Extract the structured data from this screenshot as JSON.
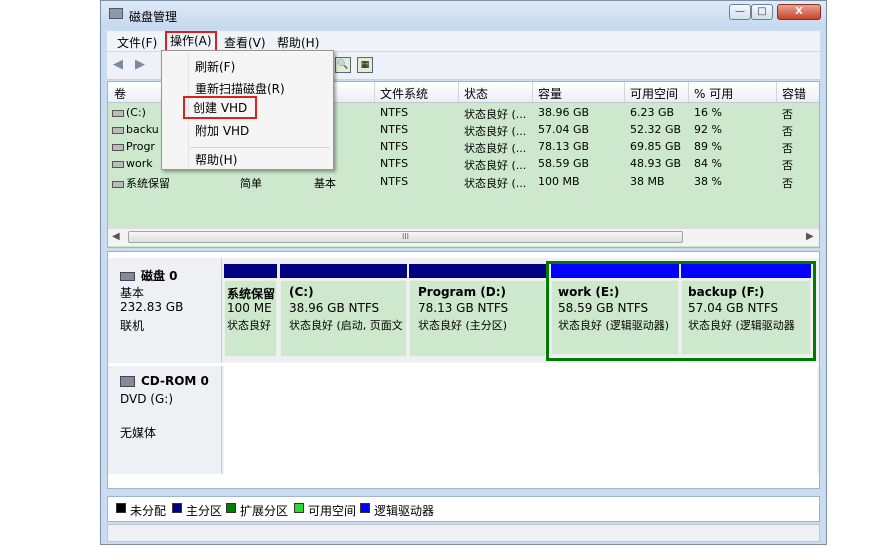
{
  "window": {
    "title": "磁盘管理",
    "buttons": {
      "minimize": "—",
      "maximize": "□",
      "close": "X"
    }
  },
  "menu": {
    "items": [
      "文件(F)",
      "操作(A)",
      "查看(V)",
      "帮助(H)"
    ],
    "active": "操作(A)"
  },
  "action_menu": {
    "items": [
      {
        "label": "刷新(F)"
      },
      {
        "label": "重新扫描磁盘(R)"
      },
      {
        "label": "创建 VHD",
        "highlighted": true
      },
      {
        "label": "附加 VHD"
      },
      {
        "label": "帮助(H)"
      }
    ]
  },
  "volume_table": {
    "columns": [
      "卷",
      "",
      "",
      "文件系统",
      "状态",
      "容量",
      "可用空间",
      "% 可用",
      "容错"
    ],
    "rows": [
      {
        "vol": "(C:)",
        "layout": "",
        "type": "",
        "fs": "NTFS",
        "status": "状态良好 (...",
        "capacity": "38.96 GB",
        "free": "6.23 GB",
        "pct": "16 %",
        "ft": "否"
      },
      {
        "vol": "backu",
        "layout": "",
        "type": "",
        "fs": "NTFS",
        "status": "状态良好 (...",
        "capacity": "57.04 GB",
        "free": "52.32 GB",
        "pct": "92 %",
        "ft": "否"
      },
      {
        "vol": "Progr",
        "layout": "",
        "type": "",
        "fs": "NTFS",
        "status": "状态良好 (...",
        "capacity": "78.13 GB",
        "free": "69.85 GB",
        "pct": "89 %",
        "ft": "否"
      },
      {
        "vol": "work",
        "layout": "",
        "type": "",
        "fs": "NTFS",
        "status": "状态良好 (...",
        "capacity": "58.59 GB",
        "free": "48.93 GB",
        "pct": "84 %",
        "ft": "否"
      },
      {
        "vol": "系统保留",
        "layout": "简单",
        "type": "基本",
        "fs": "NTFS",
        "status": "状态良好 (...",
        "capacity": "100 MB",
        "free": "38 MB",
        "pct": "38 %",
        "ft": "否"
      }
    ],
    "scroll_thumb_label": "III"
  },
  "disks": [
    {
      "name": "磁盘 0",
      "type": "基本",
      "size": "232.83 GB",
      "status": "联机",
      "partitions": [
        {
          "name": "系统保留",
          "size": "100 ME",
          "status": "状态良好",
          "kind": "primary"
        },
        {
          "name": "(C:)",
          "size": "38.96 GB NTFS",
          "status": "状态良好 (启动, 页面文",
          "kind": "primary"
        },
        {
          "name": "Program  (D:)",
          "size": "78.13 GB NTFS",
          "status": "状态良好 (主分区)",
          "kind": "primary"
        },
        {
          "name": "work  (E:)",
          "size": "58.59 GB NTFS",
          "status": "状态良好 (逻辑驱动器)",
          "kind": "logical"
        },
        {
          "name": "backup  (F:)",
          "size": "57.04 GB NTFS",
          "status": "状态良好 (逻辑驱动器",
          "kind": "logical"
        }
      ]
    },
    {
      "name": "CD-ROM 0",
      "type": "DVD (G:)",
      "status": "无媒体"
    }
  ],
  "legend": [
    {
      "label": "未分配",
      "color": "#000000"
    },
    {
      "label": "主分区",
      "color": "#000080"
    },
    {
      "label": "扩展分区",
      "color": "#008000"
    },
    {
      "label": "可用空间",
      "color": "#2cdc2c"
    },
    {
      "label": "逻辑驱动器",
      "color": "#0000ff"
    }
  ],
  "colors": {
    "primary_bar": "#000080",
    "logical_bar": "#0000ff",
    "extended_border": "#007a00",
    "volume_bg": "#cde8cd",
    "highlight_red": "#e01e1e"
  }
}
